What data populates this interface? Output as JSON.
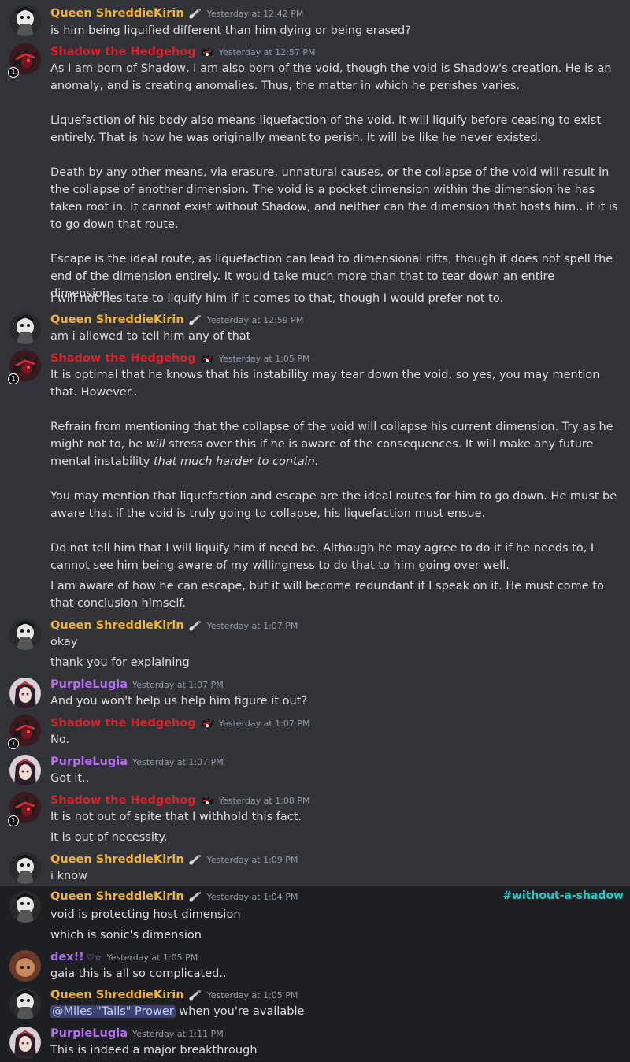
{
  "colors": {
    "queen": "#f0b232",
    "shadow": "#e0202a",
    "purple": "#b86cf0",
    "channel": "#1ec8c8"
  },
  "channel_tag": "#without-a-shadow",
  "users": {
    "queen": "Queen ShreddieKirin",
    "shadow": "Shadow the Hedgehog",
    "purple": "PurpleLugia",
    "dex": "dex!!",
    "dex_hearts": "♡☆"
  },
  "mention": "@Miles \"Tails\" Prower",
  "messages": [
    {
      "ts": "Yesterday at 12:42 PM",
      "lines": [
        "is him being liquified different than him dying or being erased?"
      ]
    },
    {
      "ts": "Yesterday at 12:57 PM",
      "lines": [
        "As I am born of Shadow, I am also born of the void, though the void is Shadow's creation. He is an anomaly, and is creating anomalies. Thus, the matter in which he perishes varies.",
        "Liquefaction of his body also means liquefaction of the void. It will liquify before ceasing to exist entirely. That is how he was originally meant to perish. It will be like he never existed.",
        "Death by any other means, via erasure, unnatural causes, or the collapse of the void will result in the collapse of another dimension. The void is a pocket dimension within the dimension he has taken root in. It cannot exist without Shadow, and neither can the dimension that hosts him.. if it is to go down that route.",
        "Escape is the ideal route, as liquefaction can lead to dimensional rifts, though it does not spell the end of the dimension entirely. It would take much more than that to tear down an entire dimension.",
        "I will not hesitate to liquify him if it comes to that, though I would prefer not to."
      ]
    },
    {
      "ts": "Yesterday at 12:59 PM",
      "lines": [
        "am i allowed to tell him any of that"
      ]
    },
    {
      "ts": "Yesterday at 1:05 PM",
      "lines": [
        "It is optimal that he knows that his instability may tear down the void, so yes, you may mention that. However..",
        "Refrain from mentioning that the collapse of the void will collapse his current dimension. Try as he might not to, he ",
        "will",
        " stress over this if he is aware of the consequences. It will make any future mental instability ",
        "that much harder to contain.",
        "You may mention that liquefaction and escape are the ideal routes for him to go down. He must be aware that if the void is truly going to collapse, his liquefaction must ensue.",
        "Do not tell him that I will liquify him if need be. Although he may agree to do it if he needs to, I cannot see him being aware of my willingness to do that to him going over well.",
        "I am aware of how he can escape, but it will become redundant if I speak on it. He must come to that conclusion himself."
      ]
    },
    {
      "ts": "Yesterday at 1:07 PM",
      "lines": [
        "okay",
        "thank you for explaining"
      ]
    },
    {
      "ts": "Yesterday at 1:07 PM",
      "lines": [
        "And you won't help us help him figure it out?"
      ]
    },
    {
      "ts": "Yesterday at 1:07 PM",
      "lines": [
        "No."
      ]
    },
    {
      "ts": "Yesterday at 1:07 PM",
      "lines": [
        "Got it.."
      ]
    },
    {
      "ts": "Yesterday at 1:08 PM",
      "lines": [
        "It is not out of spite that I withhold this fact.",
        "It is out of necessity."
      ]
    },
    {
      "ts": "Yesterday at 1:09 PM",
      "lines": [
        "i know"
      ]
    },
    {
      "ts": "Yesterday at 1:04 PM",
      "lines": [
        "void is protecting host dimension",
        "which is sonic's dimension"
      ]
    },
    {
      "ts": "Yesterday at 1:05 PM",
      "lines": [
        "gaia this is all so complicated.."
      ]
    },
    {
      "ts": "Yesterday at 1:05 PM",
      "lines": [
        " when you're available"
      ]
    },
    {
      "ts": "Yesterday at 1:11 PM",
      "lines": [
        "This is indeed a major breakthrough"
      ]
    }
  ]
}
